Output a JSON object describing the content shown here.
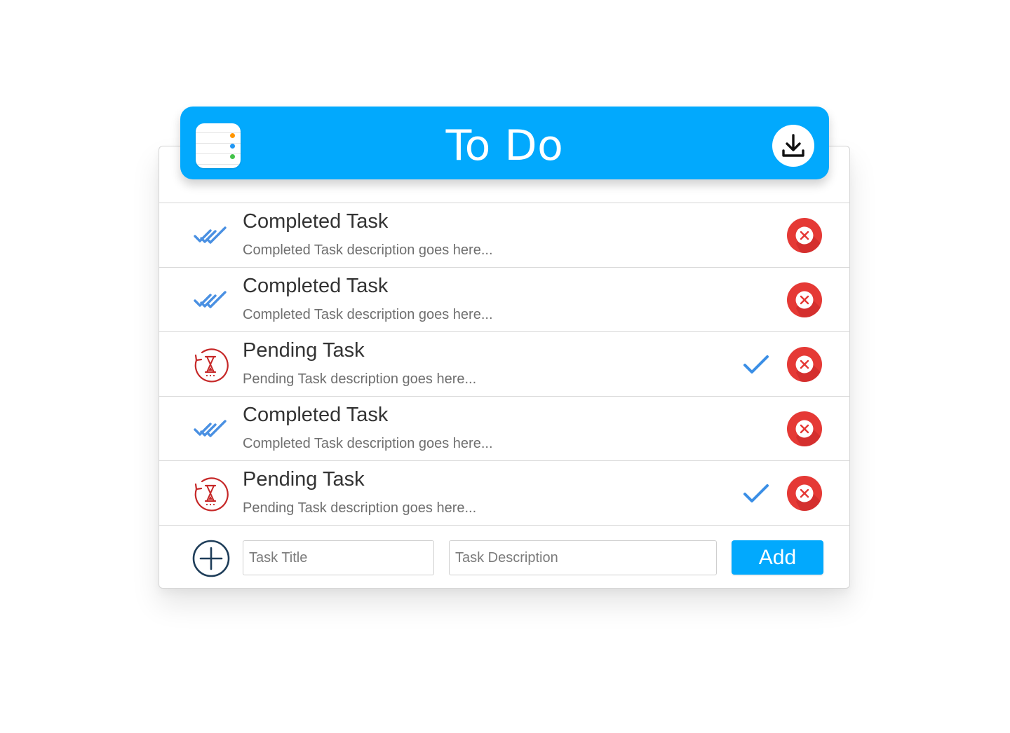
{
  "header": {
    "title": "To Do",
    "app_icon": "reminders-list-icon",
    "download_icon": "download-icon",
    "bar_color": "#02a9fd"
  },
  "tasks": [
    {
      "title": "Completed Task",
      "description": "Completed Task description goes here...",
      "status": "completed",
      "status_icon": "double-check-icon",
      "has_complete_button": false
    },
    {
      "title": "Completed Task",
      "description": "Completed Task description goes here...",
      "status": "completed",
      "status_icon": "double-check-icon",
      "has_complete_button": false
    },
    {
      "title": "Pending Task",
      "description": "Pending Task description goes here...",
      "status": "pending",
      "status_icon": "hourglass-refresh-icon",
      "has_complete_button": true
    },
    {
      "title": "Completed Task",
      "description": "Completed Task description goes here...",
      "status": "completed",
      "status_icon": "double-check-icon",
      "has_complete_button": false
    },
    {
      "title": "Pending Task",
      "description": "Pending Task description goes here...",
      "status": "pending",
      "status_icon": "hourglass-refresh-icon",
      "has_complete_button": true
    }
  ],
  "add_form": {
    "title_placeholder": "Task Title",
    "title_value": "",
    "description_placeholder": "Task Description",
    "description_value": "",
    "add_label": "Add",
    "plus_icon": "plus-circle-icon"
  },
  "colors": {
    "accent": "#02a9fd",
    "completed_check": "#4a90e2",
    "pending_icon": "#c62828",
    "delete": "#e53935",
    "plus": "#1e3d59"
  }
}
